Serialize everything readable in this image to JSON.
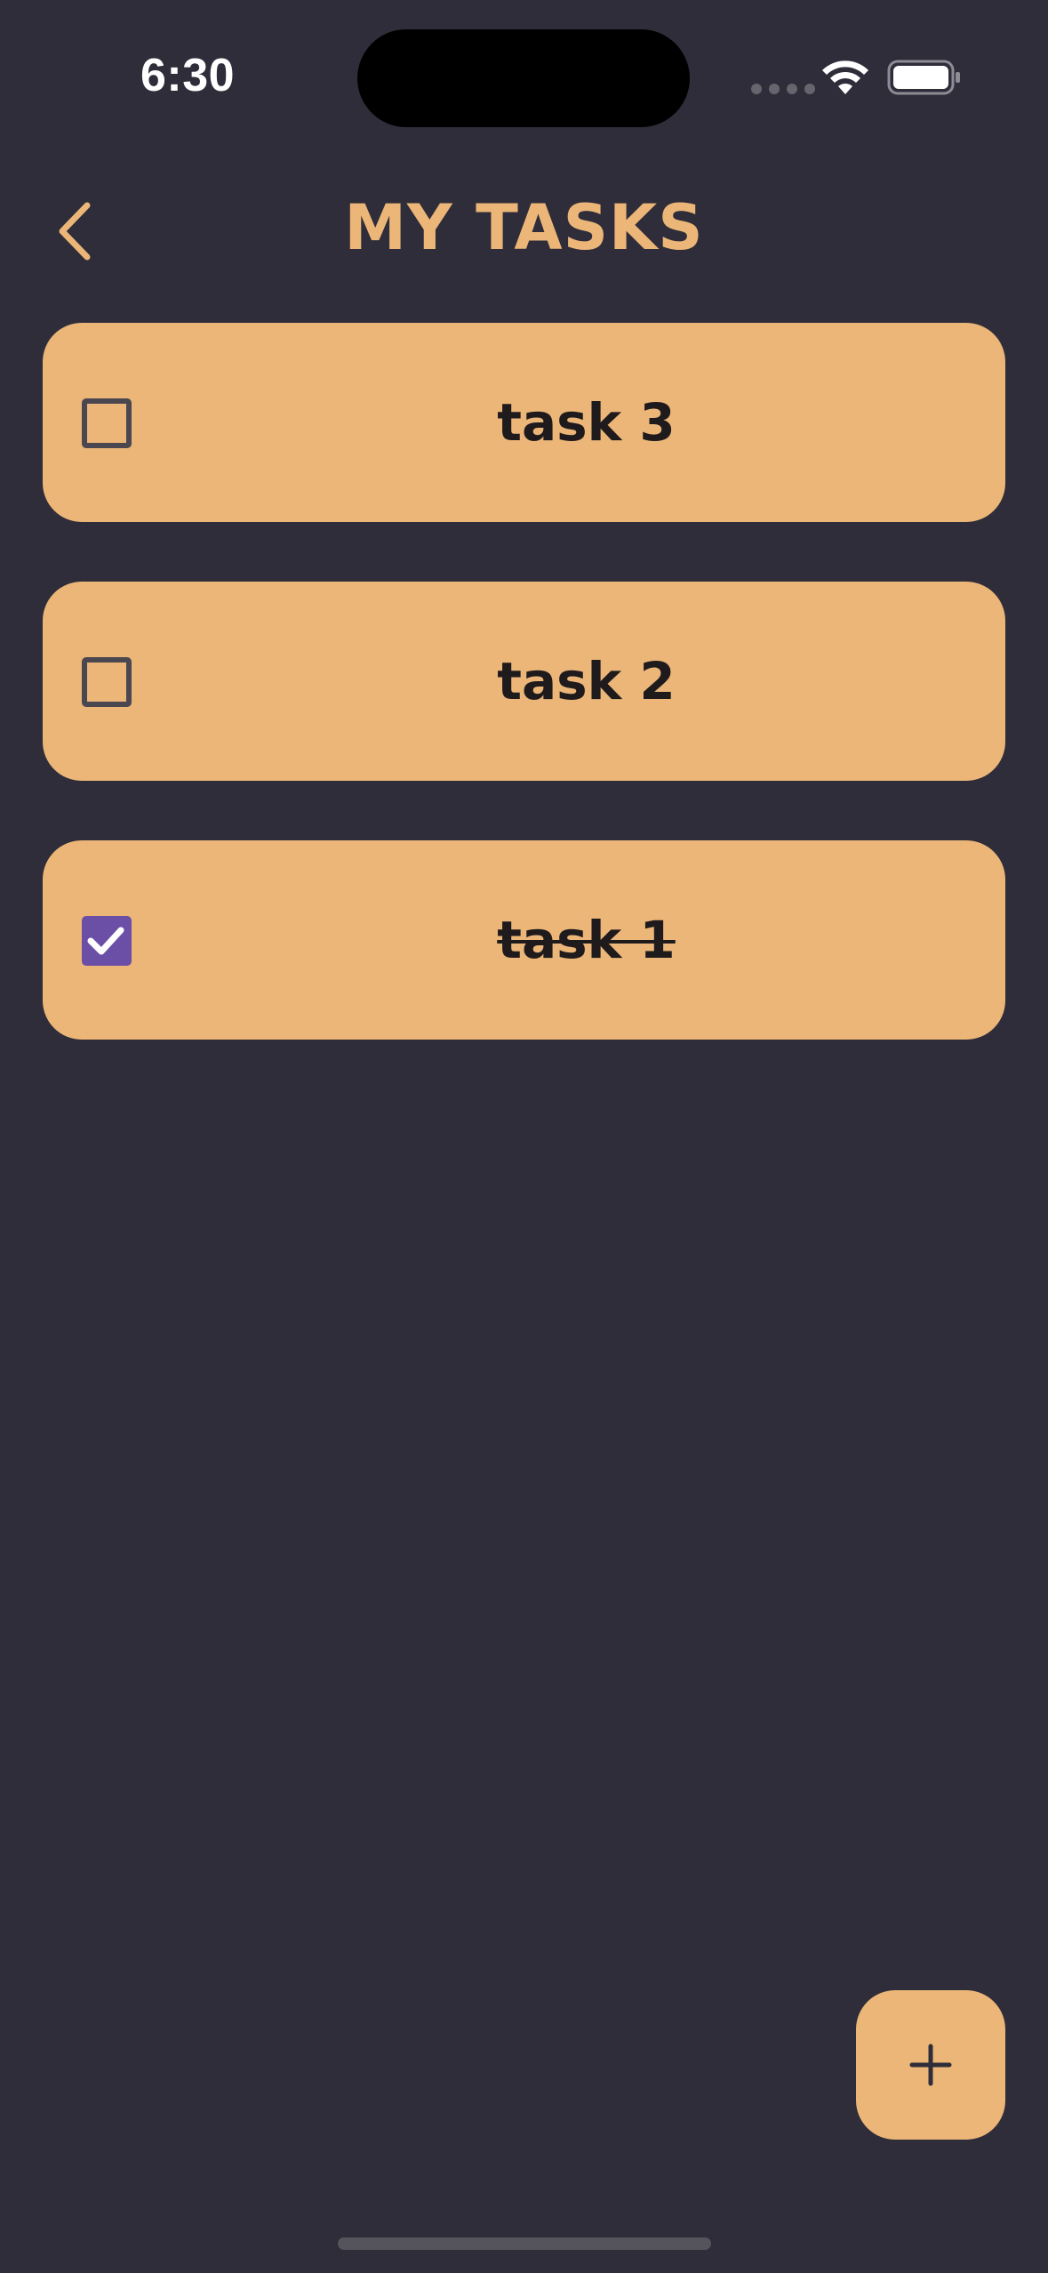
{
  "status_bar": {
    "time": "6:30"
  },
  "header": {
    "title": "MY TASKS",
    "back_icon": "chevron-left-icon"
  },
  "tasks": [
    {
      "label": "task 3",
      "done": false
    },
    {
      "label": "task 2",
      "done": false
    },
    {
      "label": "task 1",
      "done": true
    }
  ],
  "fab": {
    "icon": "plus-icon"
  },
  "colors": {
    "background": "#2f2d39",
    "accent": "#ebb678",
    "checkbox_checked": "#6b4fa7",
    "checkbox_border": "#4b4750",
    "text_dark": "#1f1b1d"
  }
}
